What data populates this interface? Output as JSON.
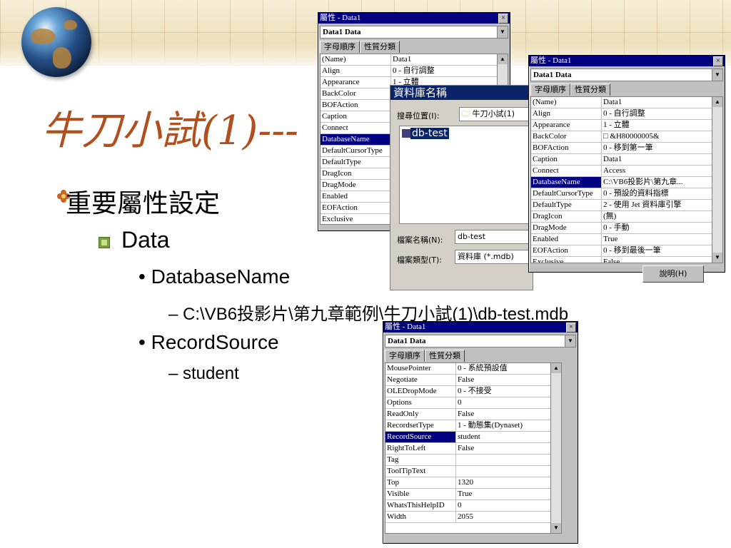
{
  "slide": {
    "title": "牛刀小試(1)---",
    "bullet_level1": "重要屬性設定",
    "bullet_level2": "Data",
    "bullet_databasename": "DatabaseName",
    "bullet_path": "– C:\\VB6投影片\\第九章範例\\牛刀小試(1)\\db-test.mdb",
    "bullet_recordsource": "RecordSource",
    "bullet_student": "– student"
  },
  "colors": {
    "title": "#b1501e",
    "titlebar": "#000080",
    "selection": "#000080"
  },
  "win_left": {
    "title": "屬性 - Data1",
    "object": "Data1 Data",
    "tab_alpha": "字母順序",
    "tab_cat": "性質分類",
    "rows": [
      {
        "n": "(Name)",
        "v": "Data1"
      },
      {
        "n": "Align",
        "v": "0 - 自行調整"
      },
      {
        "n": "Appearance",
        "v": "1 - 立體"
      },
      {
        "n": "BackColor",
        "v": ""
      },
      {
        "n": "BOFAction",
        "v": ""
      },
      {
        "n": "Caption",
        "v": ""
      },
      {
        "n": "Connect",
        "v": ""
      },
      {
        "n": "DatabaseName",
        "v": "",
        "sel": true
      },
      {
        "n": "DefaultCursorType",
        "v": ""
      },
      {
        "n": "DefaultType",
        "v": ""
      },
      {
        "n": "DragIcon",
        "v": ""
      },
      {
        "n": "DragMode",
        "v": ""
      },
      {
        "n": "Enabled",
        "v": ""
      },
      {
        "n": "EOFAction",
        "v": ""
      },
      {
        "n": "Exclusive",
        "v": ""
      }
    ]
  },
  "dialog": {
    "title": "資料庫名稱",
    "look_in_label": "搜尋位置(I):",
    "look_in_value": "牛刀小試(1)",
    "file_item": "db-test",
    "filename_label": "檔案名稱(N):",
    "filename_value": "db-test",
    "filetype_label": "檔案類型(T):",
    "filetype_value": "資料庫 (*.mdb)"
  },
  "win_right": {
    "title": "屬性 - Data1",
    "object": "Data1 Data",
    "tab_alpha": "字母順序",
    "tab_cat": "性質分類",
    "rows": [
      {
        "n": "(Name)",
        "v": "Data1"
      },
      {
        "n": "Align",
        "v": "0 - 自行調整"
      },
      {
        "n": "Appearance",
        "v": "1 - 立體"
      },
      {
        "n": "BackColor",
        "v": "□ &H80000005&"
      },
      {
        "n": "BOFAction",
        "v": "0 - 移到第一筆"
      },
      {
        "n": "Caption",
        "v": "Data1"
      },
      {
        "n": "Connect",
        "v": "Access"
      },
      {
        "n": "DatabaseName",
        "v": "C:\\VB6投影片\\第九章...",
        "sel": true
      },
      {
        "n": "DefaultCursorType",
        "v": "0 - 預設的資料指標"
      },
      {
        "n": "DefaultType",
        "v": "2 - 使用 Jet 資料庫引擎"
      },
      {
        "n": "DragIcon",
        "v": "(無)"
      },
      {
        "n": "DragMode",
        "v": "0 - 手動"
      },
      {
        "n": "Enabled",
        "v": "True"
      },
      {
        "n": "EOFAction",
        "v": "0 - 移到最後一筆"
      },
      {
        "n": "Exclusive",
        "v": "False"
      }
    ],
    "help_button": "說明(H)"
  },
  "win_bottom": {
    "title": "屬性 - Data1",
    "object": "Data1 Data",
    "tab_alpha": "字母順序",
    "tab_cat": "性質分類",
    "rows": [
      {
        "n": "MousePointer",
        "v": "0 - 系統預設值"
      },
      {
        "n": "Negotiate",
        "v": "False"
      },
      {
        "n": "OLEDropMode",
        "v": "0 - 不接受"
      },
      {
        "n": "Options",
        "v": "0"
      },
      {
        "n": "ReadOnly",
        "v": "False"
      },
      {
        "n": "RecordsetType",
        "v": "1 - 動態集(Dynaset)"
      },
      {
        "n": "RecordSource",
        "v": "student",
        "sel": true
      },
      {
        "n": "RightToLeft",
        "v": "False"
      },
      {
        "n": "Tag",
        "v": ""
      },
      {
        "n": "ToolTipText",
        "v": ""
      },
      {
        "n": "Top",
        "v": "1320"
      },
      {
        "n": "Visible",
        "v": "True"
      },
      {
        "n": "WhatsThisHelpID",
        "v": "0"
      },
      {
        "n": "Width",
        "v": "2055"
      }
    ]
  }
}
